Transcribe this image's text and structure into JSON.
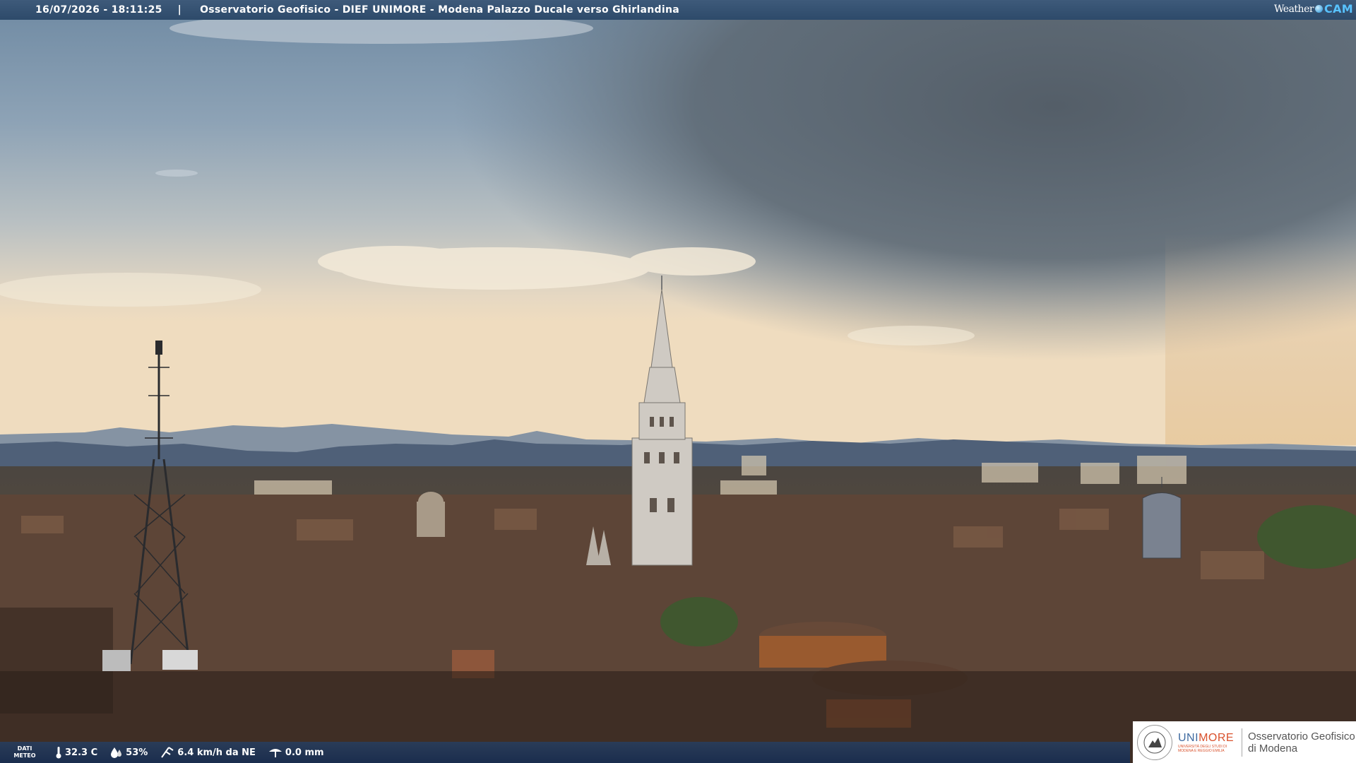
{
  "header": {
    "timestamp": "16/07/2026 - 18:11:25",
    "separator": "|",
    "title": "Osservatorio Geofisico - DIEF UNIMORE - Modena Palazzo Ducale verso Ghirlandina"
  },
  "brand": {
    "weather": "Weather",
    "cam": "CAM"
  },
  "footer": {
    "label_line1": "DATI",
    "label_line2": "METEO",
    "temperature": "32.3 C",
    "humidity": "53%",
    "wind": "6.4 km/h da NE",
    "rain": "0.0 mm",
    "icons": [
      "thermometer-icon",
      "humidity-drop-icon",
      "wind-icon",
      "rain-gauge-icon"
    ]
  },
  "logo": {
    "university": "UNIMORE",
    "university_highlight": "MORE",
    "university_sub": "UNIVERSITÀ DEGLI STUDI DI MODENA E REGGIO EMILIA",
    "observatory_line1": "Osservatorio Geofisico",
    "observatory_line2": "di Modena"
  },
  "colors": {
    "sky_top": "#6f8aa3",
    "sky_glow": "#efdcbf",
    "storm_cloud": "#56606a",
    "mountains": "#4a5c74",
    "roofs": "#3a2a22"
  }
}
